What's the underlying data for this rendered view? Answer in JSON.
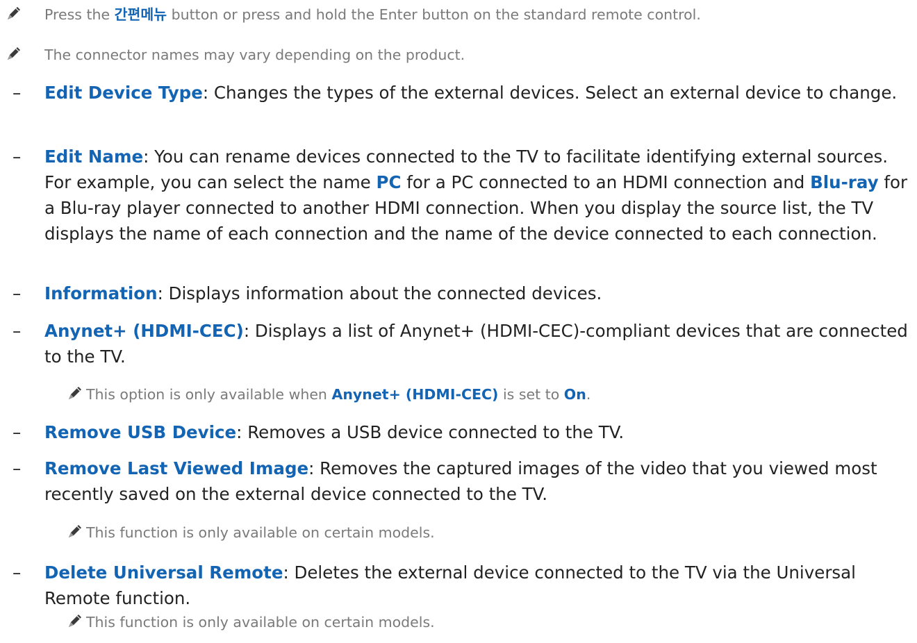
{
  "notes": {
    "n1": {
      "pre": "Press the ",
      "term": "간편메뉴",
      "post": " button or press and hold the Enter button on the standard remote control."
    },
    "n2": {
      "text": "The connector names may vary depending on the product."
    },
    "n3": {
      "pre": "This option is only available when ",
      "term": "Anynet+ (HDMI-CEC)",
      "mid": " is set to ",
      "term2": "On",
      "post": "."
    },
    "n4": {
      "text": "This function is only available on certain models."
    },
    "n5": {
      "text": "This function is only available on certain models."
    }
  },
  "items": {
    "dash": "–",
    "edit_device_type": {
      "term": "Edit Device Type",
      "text": ": Changes the types of the external devices. Select an external device to change."
    },
    "edit_name": {
      "term": "Edit Name",
      "text1": ": You can rename devices connected to the TV to facilitate identifying external sources. For example, you can select the name ",
      "term_pc": "PC",
      "text2": " for a PC connected to an HDMI connection and ",
      "term_bluray": "Blu-ray",
      "text3": " for a Blu-ray player connected to another HDMI connection. When you display the source list, the TV displays the name of each connection and the name of the device connected to each connection."
    },
    "information": {
      "term": "Information",
      "text": ": Displays information about the connected devices."
    },
    "anynet": {
      "term": "Anynet+ (HDMI-CEC)",
      "text": ": Displays a list of Anynet+ (HDMI-CEC)-compliant devices that are connected to the TV."
    },
    "remove_usb": {
      "term": "Remove USB Device",
      "text": ": Removes a USB device connected to the TV."
    },
    "remove_last": {
      "term": "Remove Last Viewed Image",
      "text": ": Removes the captured images of the video that you viewed most recently saved on the external device connected to the TV."
    },
    "delete_universal": {
      "term": "Delete Universal Remote",
      "text": ": Deletes the external device connected to the TV via the Universal Remote function."
    }
  },
  "colors": {
    "highlight": "#1464b4",
    "note_text": "#7a7a7a",
    "body_text": "#222222"
  },
  "icons": {
    "note": "pencil-icon"
  }
}
